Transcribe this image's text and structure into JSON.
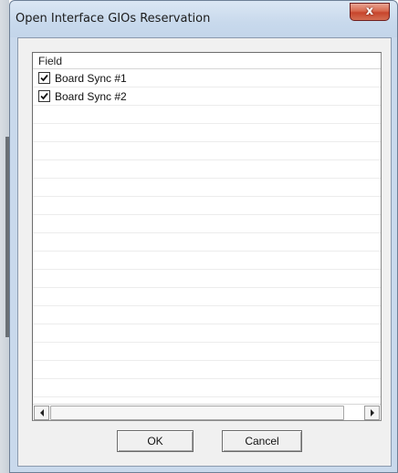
{
  "window": {
    "title": "Open Interface GIOs Reservation",
    "close_glyph": "x"
  },
  "list": {
    "column_header": "Field",
    "rows": [
      {
        "label": "Board Sync #1",
        "checked": true
      },
      {
        "label": "Board Sync #2",
        "checked": true
      }
    ],
    "empty_rows": 16
  },
  "buttons": {
    "ok_label": "OK",
    "cancel_label": "Cancel"
  },
  "icons": {
    "checkbox": "checkmark-icon",
    "scroll_left": "arrow-left-icon",
    "scroll_right": "arrow-right-icon",
    "close": "close-icon"
  },
  "colors": {
    "title_bar": "#c8d9ec",
    "close_button": "#c7452c",
    "client_bg": "#f0f0f0"
  }
}
